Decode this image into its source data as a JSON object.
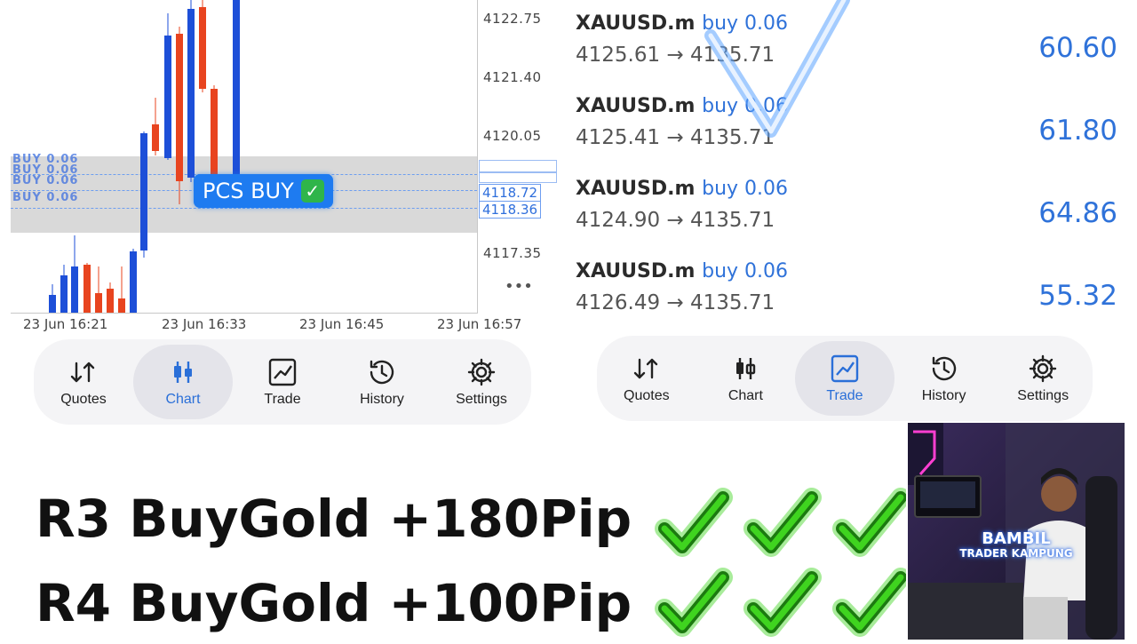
{
  "chart": {
    "price_axis": [
      "4122.75",
      "4121.40",
      "4120.05",
      "4117.35"
    ],
    "time_axis": [
      "23 Jun 16:21",
      "23 Jun 16:33",
      "23 Jun 16:45",
      "23 Jun 16:57"
    ],
    "price_tags": [
      "4118.72",
      "4118.36"
    ],
    "order_line_ghost": "BUY 0.06",
    "more_label": "•••",
    "signal_badge": "PCS BUY",
    "candle_colors": {
      "up": "#1d4fd8",
      "down": "#e8441f"
    }
  },
  "nav_left": {
    "items": [
      {
        "label": "Quotes",
        "icon": "quotes-icon"
      },
      {
        "label": "Chart",
        "icon": "chart-candles-icon"
      },
      {
        "label": "Trade",
        "icon": "trade-icon"
      },
      {
        "label": "History",
        "icon": "history-icon"
      },
      {
        "label": "Settings",
        "icon": "gear-icon"
      }
    ],
    "active": "Chart"
  },
  "nav_right": {
    "items": [
      {
        "label": "Quotes",
        "icon": "quotes-icon"
      },
      {
        "label": "Chart",
        "icon": "chart-candles-icon"
      },
      {
        "label": "Trade",
        "icon": "trade-icon"
      },
      {
        "label": "History",
        "icon": "history-icon"
      },
      {
        "label": "Settings",
        "icon": "gear-icon"
      }
    ],
    "active": "Trade"
  },
  "trades": [
    {
      "symbol": "XAUUSD.m",
      "direction": "buy 0.06",
      "open": "4125.61",
      "close": "4135.71",
      "profit": "60.60"
    },
    {
      "symbol": "XAUUSD.m",
      "direction": "buy 0.06",
      "open": "4125.41",
      "close": "4135.71",
      "profit": "61.80"
    },
    {
      "symbol": "XAUUSD.m",
      "direction": "buy 0.06",
      "open": "4124.90",
      "close": "4135.71",
      "profit": "64.86"
    },
    {
      "symbol": "XAUUSD.m",
      "direction": "buy 0.06",
      "open": "4126.49",
      "close": "4135.71",
      "profit": "55.32"
    }
  ],
  "arrow_glyph": "→",
  "headlines": [
    {
      "text": "R3 BuyGold +180Pip"
    },
    {
      "text": "R4 BuyGold +100Pip"
    }
  ],
  "streamer": {
    "name": "BAMBIL",
    "subtitle": "TRADER KAMPUNG"
  },
  "colors": {
    "accent_blue": "#2f72d9",
    "check_green": "#3fd41f",
    "nav_bg": "#f4f4f6"
  }
}
